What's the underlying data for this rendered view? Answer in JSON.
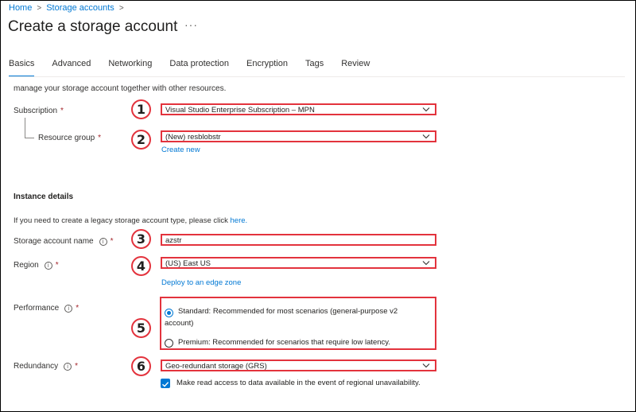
{
  "breadcrumb": {
    "home": "Home",
    "storage_accounts": "Storage accounts"
  },
  "page": {
    "title": "Create a storage account",
    "more": "···"
  },
  "tabs": [
    {
      "label": "Basics",
      "active": true
    },
    {
      "label": "Advanced"
    },
    {
      "label": "Networking"
    },
    {
      "label": "Data protection"
    },
    {
      "label": "Encryption"
    },
    {
      "label": "Tags"
    },
    {
      "label": "Review"
    }
  ],
  "project": {
    "cut_text": "manage your storage account together with other resources.",
    "subscription": {
      "label": "Subscription",
      "required": "*",
      "value": "Visual Studio Enterprise Subscription – MPN"
    },
    "resource_group": {
      "label": "Resource group",
      "required": "*",
      "value": "(New) resblobstr",
      "create_new": "Create new"
    }
  },
  "instance": {
    "heading": "Instance details",
    "legacy_text": "If you need to create a legacy storage account type, please click",
    "legacy_link": "here.",
    "name": {
      "label": "Storage account name",
      "required": "*",
      "value": "azstr"
    },
    "region": {
      "label": "Region",
      "required": "*",
      "value": "(US) East US",
      "edge_zone_link": "Deploy to an edge zone"
    },
    "performance": {
      "label": "Performance",
      "required": "*",
      "options": [
        {
          "label": "Standard: Recommended for most scenarios (general-purpose v2 account)",
          "selected": true
        },
        {
          "label": "Premium: Recommended for scenarios that require low latency.",
          "selected": false
        }
      ]
    },
    "redundancy": {
      "label": "Redundancy",
      "required": "*",
      "value": "Geo-redundant storage (GRS)",
      "read_access": {
        "label": "Make read access to data available in the event of regional unavailability.",
        "checked": true
      }
    }
  },
  "callouts": [
    "1",
    "2",
    "3",
    "4",
    "5",
    "6"
  ],
  "colors": {
    "accent": "#0078d4",
    "highlight": "#e3333d",
    "required": "#a4262c"
  }
}
